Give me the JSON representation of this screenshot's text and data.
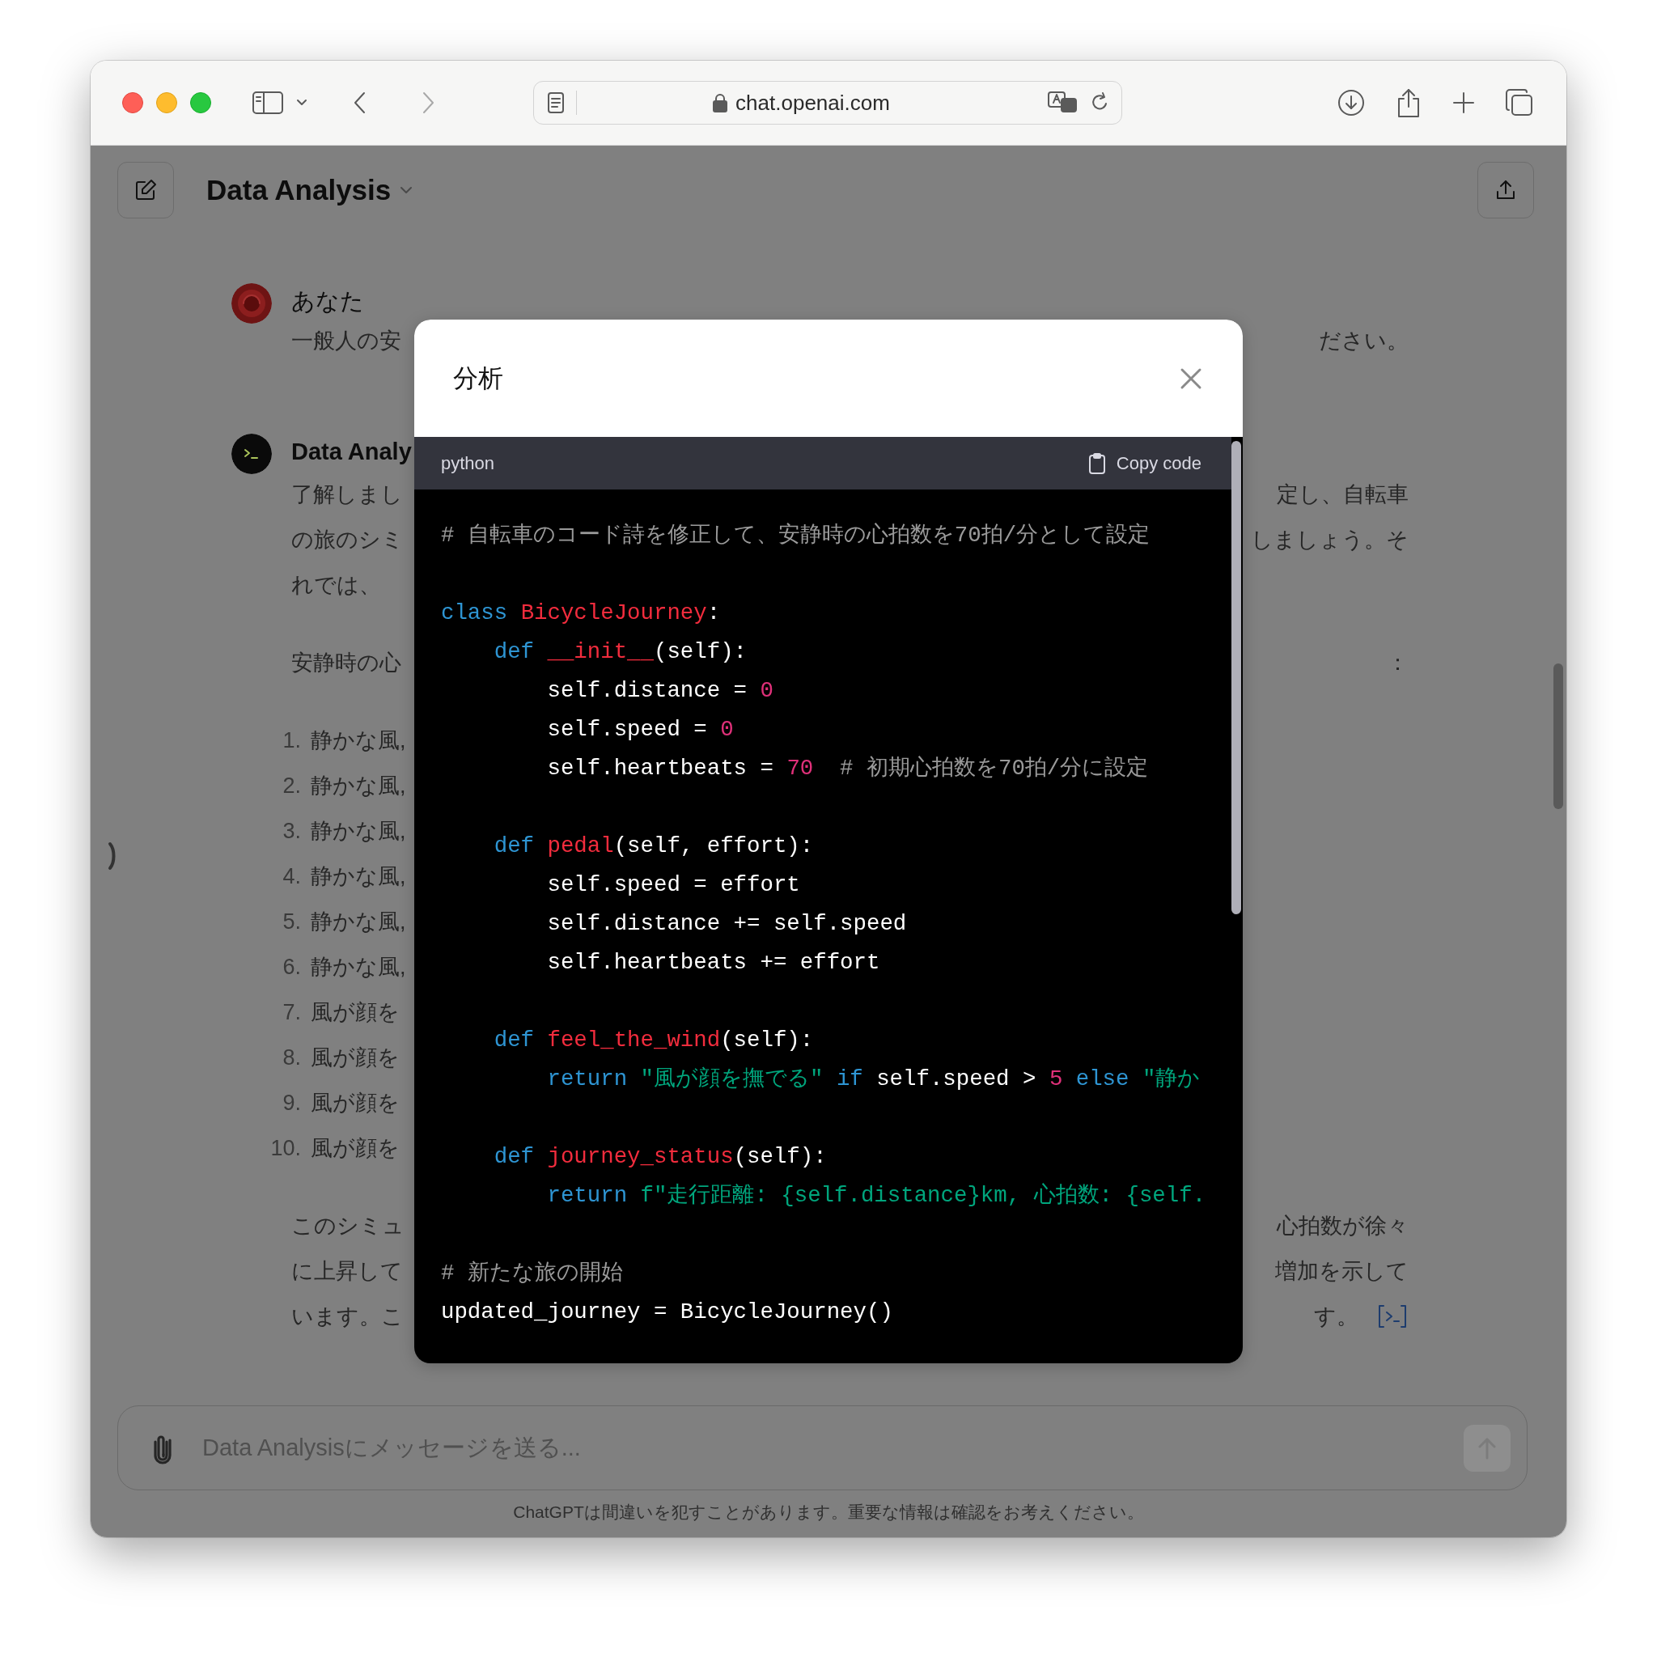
{
  "browser": {
    "url": "chat.openai.com"
  },
  "header": {
    "title": "Data Analysis"
  },
  "messages": [
    {
      "kind": "user",
      "author": "あなた",
      "blocks": [
        {
          "kind": "paragraph",
          "lines": [
            {
              "left": "一般人の安",
              "right": "ださい。"
            }
          ]
        }
      ]
    },
    {
      "kind": "assistant",
      "author": "Data Analy",
      "blocks": [
        {
          "kind": "paragraph",
          "lines": [
            {
              "left": "了解しまし",
              "right": "定し、自転車"
            },
            {
              "left": "の旅のシミ",
              "right": "しましょう。そ"
            },
            {
              "left": "れでは、"
            }
          ]
        },
        {
          "kind": "paragraph",
          "lines": [
            {
              "left": "安静時の心",
              "right": "："
            }
          ]
        },
        {
          "kind": "list",
          "items": [
            {
              "number": "1.",
              "text": "静かな風,"
            },
            {
              "number": "2.",
              "text": "静かな風,"
            },
            {
              "number": "3.",
              "text": "静かな風,"
            },
            {
              "number": "4.",
              "text": "静かな風,"
            },
            {
              "number": "5.",
              "text": "静かな風,"
            },
            {
              "number": "6.",
              "text": "静かな風,"
            },
            {
              "number": "7.",
              "text": "風が顔を"
            },
            {
              "number": "8.",
              "text": "風が顔を"
            },
            {
              "number": "9.",
              "text": "風が顔を"
            },
            {
              "number": "10.",
              "text": "風が顔を"
            }
          ]
        },
        {
          "kind": "paragraph",
          "lines": [
            {
              "left": "このシミュ",
              "right": "心拍数が徐々"
            },
            {
              "left": "に上昇して",
              "right": "増加を示して"
            },
            {
              "left": "います。こ",
              "right": "す。",
              "code_link": true
            }
          ]
        }
      ]
    }
  ],
  "modal": {
    "title": "分析",
    "code": {
      "language": "python",
      "copy_label": "Copy code",
      "sections": [
        {
          "lines": [
            {
              "tokens": [
                {
                  "kind": "comment",
                  "text": "# 自転車のコード詩を修正して、安静時の心拍数を70拍/分として設定"
                }
              ]
            }
          ]
        },
        {
          "lines": [
            {
              "tokens": [
                {
                  "kind": "keyword",
                  "text": "class "
                },
                {
                  "kind": "title",
                  "text": "BicycleJourney"
                },
                {
                  "kind": "plain",
                  "text": ":"
                }
              ]
            },
            {
              "tokens": [
                {
                  "kind": "keyword",
                  "text": "    def "
                },
                {
                  "kind": "title",
                  "text": "__init__"
                },
                {
                  "kind": "plain",
                  "text": "(self):"
                }
              ]
            },
            {
              "tokens": [
                {
                  "kind": "plain",
                  "text": "        self.distance = "
                },
                {
                  "kind": "number",
                  "text": "0"
                }
              ]
            },
            {
              "tokens": [
                {
                  "kind": "plain",
                  "text": "        self.speed = "
                },
                {
                  "kind": "number",
                  "text": "0"
                }
              ]
            },
            {
              "tokens": [
                {
                  "kind": "plain",
                  "text": "        self.heartbeats = "
                },
                {
                  "kind": "number",
                  "text": "70"
                },
                {
                  "kind": "comment",
                  "text": "  # 初期心拍数を70拍/分に設定"
                }
              ]
            }
          ]
        },
        {
          "lines": [
            {
              "tokens": [
                {
                  "kind": "keyword",
                  "text": "    def "
                },
                {
                  "kind": "title",
                  "text": "pedal"
                },
                {
                  "kind": "plain",
                  "text": "(self, effort):"
                }
              ]
            },
            {
              "tokens": [
                {
                  "kind": "plain",
                  "text": "        self.speed = effort"
                }
              ]
            },
            {
              "tokens": [
                {
                  "kind": "plain",
                  "text": "        self.distance += self.speed"
                }
              ]
            },
            {
              "tokens": [
                {
                  "kind": "plain",
                  "text": "        self.heartbeats += effort"
                }
              ]
            }
          ]
        },
        {
          "lines": [
            {
              "tokens": [
                {
                  "kind": "keyword",
                  "text": "    def "
                },
                {
                  "kind": "title",
                  "text": "feel_the_wind"
                },
                {
                  "kind": "plain",
                  "text": "(self):"
                }
              ]
            },
            {
              "tokens": [
                {
                  "kind": "keyword",
                  "text": "        return "
                },
                {
                  "kind": "string",
                  "text": "\"風が顔を撫でる\" "
                },
                {
                  "kind": "keyword",
                  "text": "if "
                },
                {
                  "kind": "plain",
                  "text": "self.speed > "
                },
                {
                  "kind": "number",
                  "text": "5 "
                },
                {
                  "kind": "keyword",
                  "text": "else "
                },
                {
                  "kind": "string",
                  "text": "\"静か"
                }
              ]
            }
          ]
        },
        {
          "lines": [
            {
              "tokens": [
                {
                  "kind": "keyword",
                  "text": "    def "
                },
                {
                  "kind": "title",
                  "text": "journey_status"
                },
                {
                  "kind": "plain",
                  "text": "(self):"
                }
              ]
            },
            {
              "tokens": [
                {
                  "kind": "keyword",
                  "text": "        return "
                },
                {
                  "kind": "string",
                  "text": "f\"走行距離: {self.distance}km, 心拍数: {self."
                }
              ]
            }
          ]
        },
        {
          "lines": [
            {
              "tokens": [
                {
                  "kind": "comment",
                  "text": "# 新たな旅の開始"
                }
              ]
            },
            {
              "tokens": [
                {
                  "kind": "plain",
                  "text": "updated_journey = BicycleJourney()"
                }
              ]
            }
          ]
        }
      ]
    }
  },
  "composer": {
    "placeholder": "Data Analysisにメッセージを送る..."
  },
  "disclaimer": "ChatGPTは間違いを犯すことがあります。重要な情報は確認をお考えください。"
}
